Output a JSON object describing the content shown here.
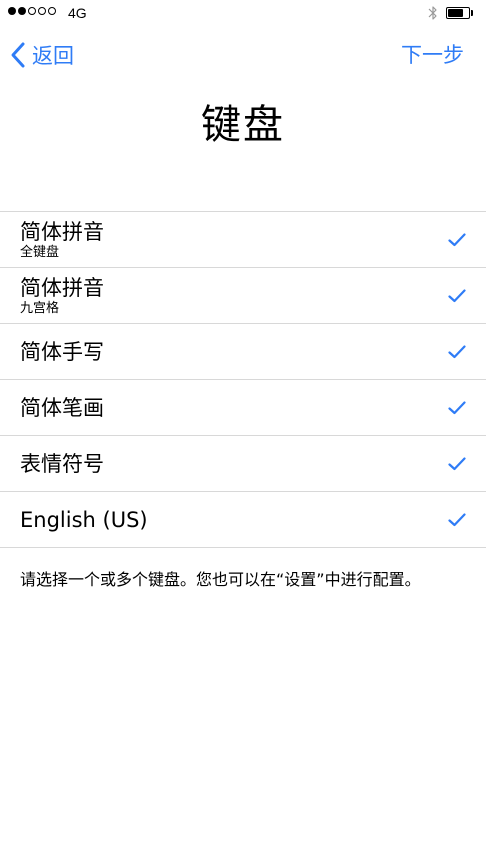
{
  "status_bar": {
    "signal_filled": 2,
    "signal_empty": 3,
    "carrier": "4G",
    "bluetooth_icon": "bluetooth-icon",
    "battery_level": 0.75
  },
  "nav": {
    "back_icon": "chevron-left-icon",
    "back_label": "返回",
    "next_label": "下一步"
  },
  "title": "键盘",
  "keyboards": [
    {
      "title": "简体拼音",
      "subtitle": "全键盘",
      "checked": true
    },
    {
      "title": "简体拼音",
      "subtitle": "九宫格",
      "checked": true
    },
    {
      "title": "简体手写",
      "subtitle": "",
      "checked": true
    },
    {
      "title": "简体笔画",
      "subtitle": "",
      "checked": true
    },
    {
      "title": "表情符号",
      "subtitle": "",
      "checked": true
    },
    {
      "title": "English (US)",
      "subtitle": "",
      "checked": true
    }
  ],
  "footer_note": "请选择一个或多个键盘。您也可以在“设置”中进行配置。",
  "colors": {
    "accent": "#2f7cf6",
    "separator": "#d8d8d8"
  }
}
